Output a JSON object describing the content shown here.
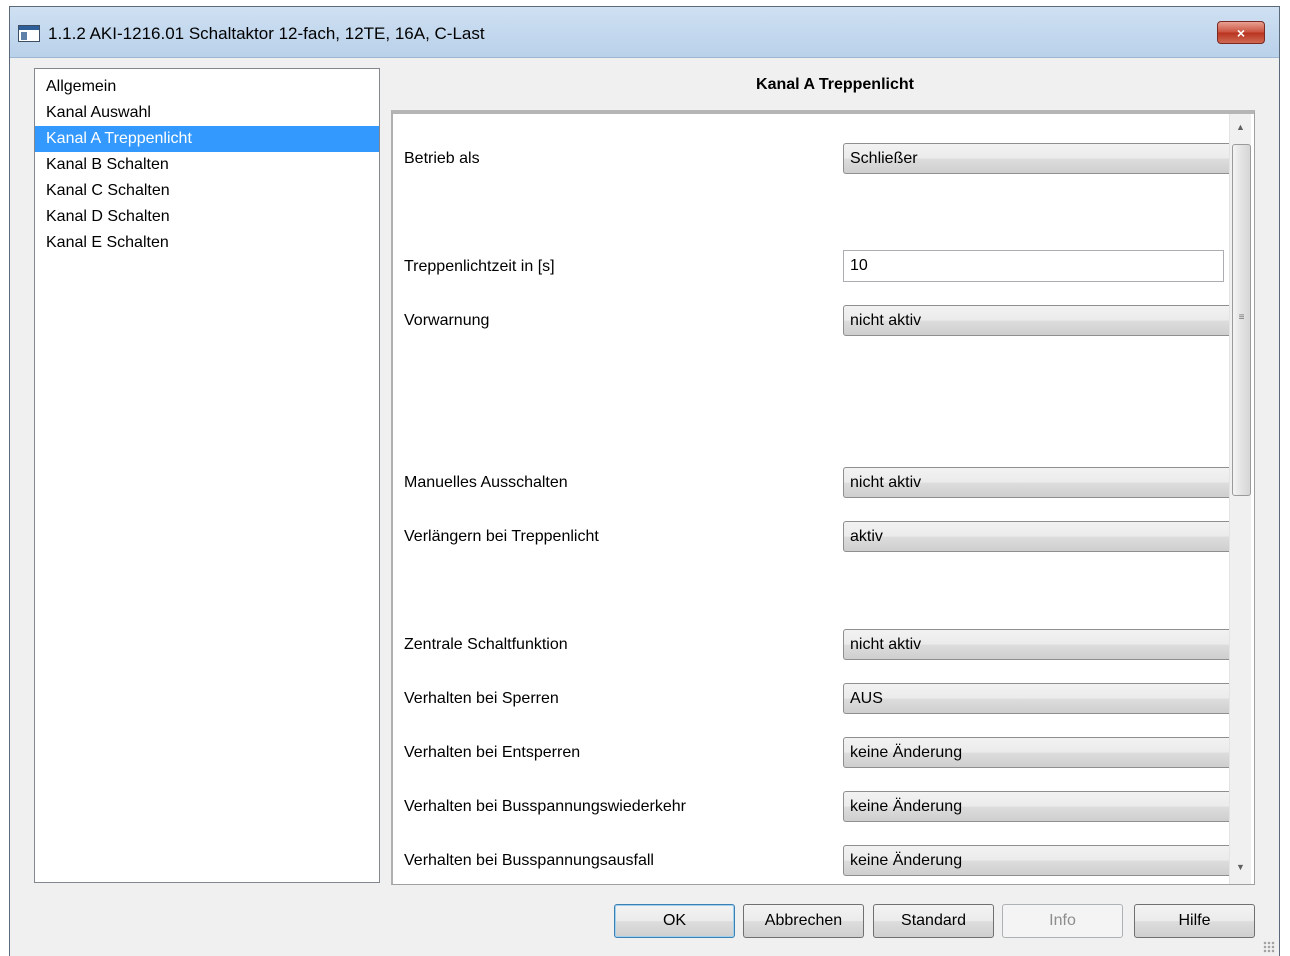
{
  "window": {
    "title": "1.1.2 AKI-1216.01 Schaltaktor 12-fach, 12TE, 16A, C-Last",
    "close_glyph": "×"
  },
  "nav": {
    "items": [
      {
        "label": "Allgemein",
        "selected": false
      },
      {
        "label": "Kanal Auswahl",
        "selected": false
      },
      {
        "label": "Kanal A Treppenlicht",
        "selected": true
      },
      {
        "label": "Kanal B Schalten",
        "selected": false
      },
      {
        "label": "Kanal C Schalten",
        "selected": false
      },
      {
        "label": "Kanal D Schalten",
        "selected": false
      },
      {
        "label": "Kanal E Schalten",
        "selected": false
      }
    ]
  },
  "panel": {
    "title": "Kanal A Treppenlicht",
    "params": {
      "betrieb_als": {
        "label": "Betrieb als",
        "value": "Schließer"
      },
      "treppenlichtzeit": {
        "label": "Treppenlichtzeit in [s]",
        "value": "10"
      },
      "vorwarnung": {
        "label": "Vorwarnung",
        "value": "nicht aktiv"
      },
      "manuelles_ausschalten": {
        "label": "Manuelles Ausschalten",
        "value": "nicht aktiv"
      },
      "verlaengern": {
        "label": "Verlängern bei Treppenlicht",
        "value": "aktiv"
      },
      "zentrale_schaltfunktion": {
        "label": "Zentrale Schaltfunktion",
        "value": "nicht aktiv"
      },
      "verhalten_sperren": {
        "label": "Verhalten bei Sperren",
        "value": "AUS"
      },
      "verhalten_entsperren": {
        "label": "Verhalten bei Entsperren",
        "value": "keine Änderung"
      },
      "verhalten_wiederkehr": {
        "label": "Verhalten bei Busspannungswiederkehr",
        "value": "keine Änderung"
      },
      "verhalten_ausfall": {
        "label": "Verhalten bei Busspannungsausfall",
        "value": "keine Änderung"
      }
    }
  },
  "buttons": {
    "ok": "OK",
    "abbrechen": "Abbrechen",
    "standard": "Standard",
    "info": "Info",
    "hilfe": "Hilfe"
  },
  "scrollbar": {
    "up_glyph": "▲",
    "down_glyph": "▼",
    "grip_glyph": "≡"
  }
}
